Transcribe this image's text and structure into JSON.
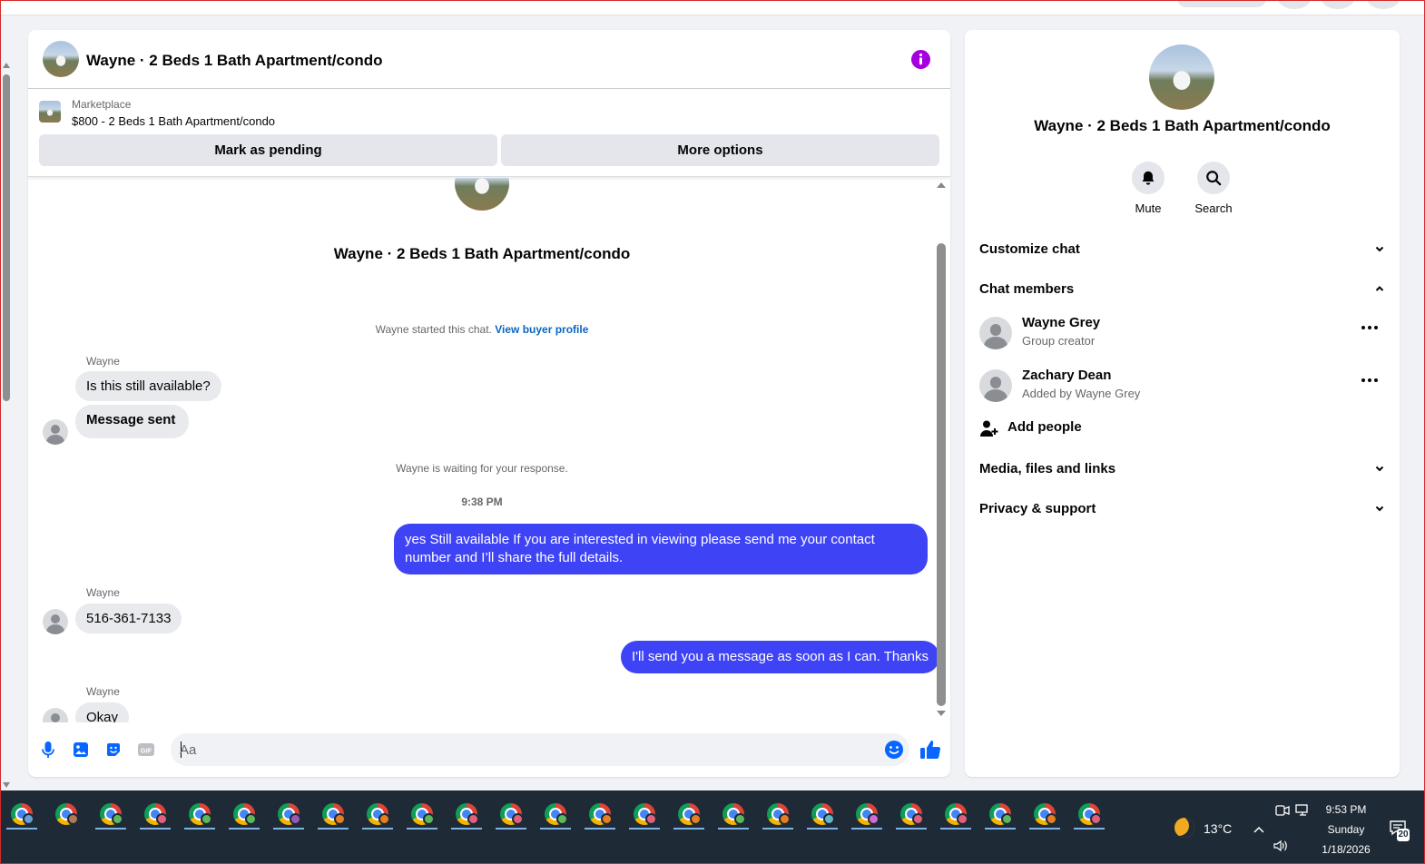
{
  "chat": {
    "header_title": "Wayne · 2 Beds 1 Bath Apartment/condo",
    "marketplace": {
      "source": "Marketplace",
      "listing": "$800 - 2 Beds 1 Bath Apartment/condo",
      "mark_pending_label": "Mark as pending",
      "more_options_label": "More options"
    },
    "conversation_title": "Wayne · 2 Beds 1 Bath Apartment/condo",
    "started_text": "Wayne started this chat.",
    "view_buyer_profile": "View buyer profile",
    "waiting_text": "Wayne is waiting for your response.",
    "timestamp": "9:38 PM",
    "messages": [
      {
        "sender": "Wayne",
        "text": "Is this still available?"
      },
      {
        "text": "Message sent"
      },
      {
        "from_me": true,
        "text": "yes Still available If you are interested in viewing please send me your contact number and I’ll share the full details."
      },
      {
        "sender": "Wayne",
        "text": "516-361-7133"
      },
      {
        "from_me": true,
        "text": "I'll send you a message as soon as I can. Thanks"
      },
      {
        "sender": "Wayne",
        "text": "Okay"
      }
    ],
    "composer_placeholder": "Aa"
  },
  "side": {
    "title": "Wayne · 2 Beds 1 Bath Apartment/condo",
    "actions": [
      {
        "label": "Mute",
        "icon": "bell-icon"
      },
      {
        "label": "Search",
        "icon": "search-icon"
      }
    ],
    "sections": {
      "customize_chat": "Customize chat",
      "chat_members": "Chat members",
      "media": "Media, files and links",
      "privacy": "Privacy & support"
    },
    "members": [
      {
        "name": "Wayne Grey",
        "role": "Group creator"
      },
      {
        "name": "Zachary Dean",
        "role": "Added by Wayne Grey"
      }
    ],
    "add_people": "Add people"
  },
  "taskbar": {
    "temperature": "13°C",
    "time": "9:53 PM",
    "day": "Sunday",
    "date": "1/18/2026",
    "notification_count": "20"
  },
  "colors": {
    "accent_blue": "#0866ff",
    "outgoing_bubble": "#3e43f5",
    "info_purple": "#a400e0"
  }
}
